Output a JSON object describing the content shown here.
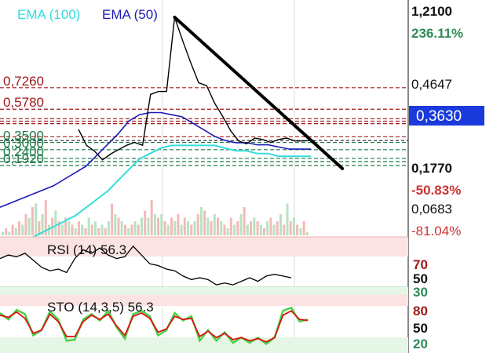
{
  "colors": {
    "ema100": "#33dddd",
    "ema50": "#1a1ab8",
    "price": "#000000",
    "trendline": "#000000",
    "fib_resistance": "#a01818",
    "fib_support": "#1f7a48",
    "price_tag_bg": "#1a3adb",
    "positive": "#2e8b57",
    "negative": "#cc3333",
    "rsi_band": "#fbe3e3",
    "sto_k": "#44d444",
    "sto_d": "#dd1111",
    "gridline": "#dddddd"
  },
  "chart_data": {
    "type": "line",
    "grid": true,
    "legend": "top-left",
    "x": [
      0,
      1,
      2,
      3,
      4,
      5,
      6,
      7,
      8,
      9,
      10,
      11,
      12,
      13,
      14,
      15,
      16,
      17,
      18,
      19,
      20,
      21,
      22,
      23,
      24,
      25,
      26,
      27,
      28,
      29,
      30,
      31,
      32,
      33,
      34,
      35,
      36,
      37,
      38
    ],
    "price_panel": {
      "legend_ema100": "EMA (100)",
      "legend_ema50": "EMA (50)",
      "price_axis_labels": [
        "1,2100",
        "0,4647",
        "0,1770",
        "0,0683"
      ],
      "percent_labels": {
        "high": "236.11%",
        "low": "-50.83%",
        "bottom": "-81.04%"
      },
      "last_price_label": "0,3630",
      "last_price": 0.363,
      "ylim": [
        0.1535,
        1.21
      ],
      "fib_levels": [
        {
          "label": "0,7260",
          "value": 0.726,
          "kind": "resistance"
        },
        {
          "label": "0,5780",
          "value": 0.578,
          "kind": "resistance"
        },
        {
          "label": "",
          "value": 0.513,
          "kind": "resistance"
        },
        {
          "label": "",
          "value": 0.496,
          "kind": "resistance"
        },
        {
          "label": "",
          "value": 0.479,
          "kind": "resistance"
        },
        {
          "label": "",
          "value": 0.389,
          "kind": "resistance"
        },
        {
          "label": "0,3500",
          "value": 0.35,
          "kind": "support"
        },
        {
          "label": "0,3000",
          "value": 0.3,
          "kind": "support"
        },
        {
          "label": "0,2400",
          "value": 0.24,
          "kind": "support"
        },
        {
          "label": "",
          "value": 0.218,
          "kind": "support"
        },
        {
          "label": "0,1920",
          "value": 0.192,
          "kind": "support"
        }
      ],
      "series": [
        {
          "name": "Price",
          "values": [
            0.44,
            0.33,
            0.29,
            0.23,
            0.27,
            0.3,
            0.33,
            0.35,
            0.33,
            0.68,
            0.7,
            0.7,
            1.21,
            1.05,
            0.9,
            0.76,
            0.74,
            0.62,
            0.53,
            0.43,
            0.36,
            0.34,
            0.38,
            0.37,
            0.35,
            0.37,
            0.38,
            0.36,
            0.36,
            0.363,
            null,
            null,
            null,
            null,
            null,
            null,
            null,
            null,
            null
          ]
        },
        {
          "name": "EMA (100)",
          "values": [
            0.0683,
            0.078,
            0.088,
            0.1,
            0.12,
            0.14,
            0.16,
            0.18,
            0.21,
            0.24,
            0.27,
            0.31,
            0.35,
            0.39,
            0.41,
            0.43,
            0.44,
            0.44,
            0.44,
            0.44,
            0.44,
            0.43,
            0.42,
            0.42,
            0.41,
            0.41,
            0.4,
            0.4,
            0.4,
            0.4,
            null,
            null,
            null,
            null,
            null,
            null,
            null,
            null,
            null
          ]
        },
        {
          "name": "EMA (50)",
          "values": [
            0.12,
            0.14,
            0.16,
            0.18,
            0.2,
            0.22,
            0.25,
            0.28,
            0.31,
            0.36,
            0.41,
            0.46,
            0.52,
            0.55,
            0.56,
            0.56,
            0.55,
            0.54,
            0.51,
            0.48,
            0.45,
            0.43,
            0.42,
            0.42,
            0.41,
            0.41,
            0.4,
            0.39,
            0.39,
            0.39,
            null,
            null,
            null,
            null,
            null,
            null,
            null,
            null,
            null
          ]
        }
      ],
      "trendline": {
        "x1": 12,
        "y1": 1.21,
        "x2": 31,
        "y2": 0.305
      }
    },
    "volume_panel": {
      "values": [
        1,
        2,
        1,
        3,
        2,
        4,
        3,
        6,
        5,
        8,
        9,
        4,
        6,
        10,
        3,
        5,
        7,
        4,
        3,
        5,
        4,
        3,
        2,
        4,
        3,
        2,
        5,
        3,
        4,
        2,
        3,
        2,
        4,
        9,
        6,
        5,
        4,
        3,
        2,
        3,
        4,
        3,
        5,
        7,
        5,
        10,
        6,
        5,
        6,
        4,
        3,
        5,
        4,
        6,
        3,
        5,
        4,
        3,
        4,
        6,
        8,
        7,
        5,
        4,
        6,
        5,
        4,
        3,
        2,
        5,
        3,
        4,
        6,
        8,
        3,
        4,
        5,
        4,
        3,
        2,
        4,
        5,
        3,
        4,
        6,
        3,
        9,
        4,
        5,
        3,
        2,
        4,
        1
      ]
    },
    "rsi_panel": {
      "label": "RSI (14) 56.3",
      "levels": [
        "70",
        "50",
        "30"
      ],
      "values": [
        58,
        62,
        60,
        64,
        56,
        48,
        44,
        46,
        42,
        58,
        68,
        64,
        70,
        62,
        58,
        60,
        72,
        62,
        52,
        50,
        46,
        44,
        38,
        34,
        36,
        34,
        28,
        30,
        28,
        32,
        36,
        32,
        38,
        40,
        38,
        36,
        null,
        null,
        null
      ]
    },
    "sto_panel": {
      "label": "STO (14,3,5) 56.3",
      "levels": [
        "80",
        "50",
        "20"
      ],
      "series": [
        {
          "name": "%K",
          "values": [
            72,
            60,
            78,
            70,
            30,
            40,
            75,
            60,
            20,
            22,
            60,
            70,
            58,
            76,
            46,
            24,
            70,
            76,
            66,
            30,
            40,
            72,
            58,
            66,
            20,
            40,
            20,
            36,
            16,
            26,
            16,
            26,
            14,
            26,
            76,
            82,
            56,
            60,
            null
          ]
        },
        {
          "name": "%D",
          "values": [
            68,
            64,
            74,
            62,
            34,
            40,
            70,
            56,
            28,
            28,
            56,
            68,
            60,
            70,
            48,
            30,
            66,
            72,
            62,
            36,
            42,
            66,
            60,
            62,
            28,
            38,
            26,
            34,
            22,
            26,
            20,
            24,
            18,
            26,
            68,
            76,
            60,
            58,
            null
          ]
        }
      ]
    }
  }
}
